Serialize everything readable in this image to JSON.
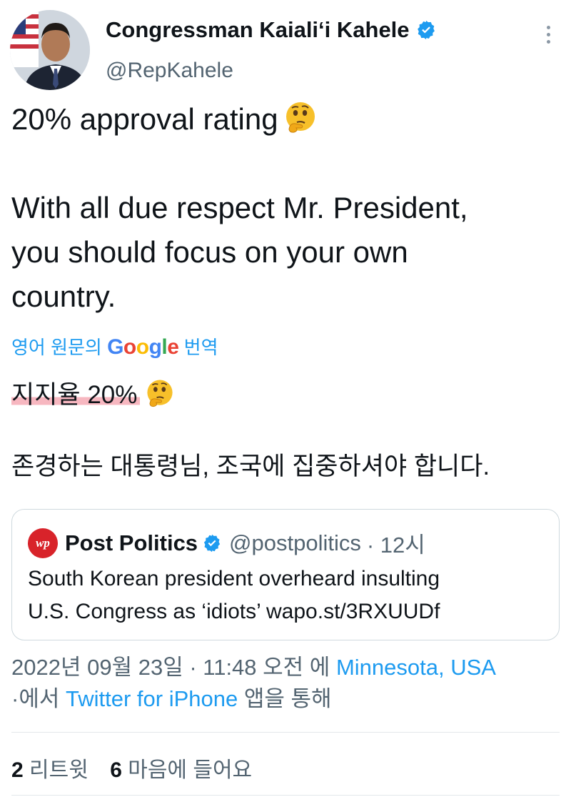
{
  "author": {
    "name": "Congressman Kaiali‘i Kahele",
    "handle": "@RepKahele"
  },
  "tweet": {
    "line1": "20% approval rating",
    "line2": "With all due respect Mr. President,",
    "line3": "you should focus on your own",
    "line4": "country."
  },
  "translation": {
    "prefix": "영어 원문의",
    "google": "Google",
    "suffix": "번역",
    "line1": "지지율 20%",
    "line2": "존경하는 대통령님, 조국에 집중하셔야 합니다."
  },
  "quote": {
    "logo_text": "wp",
    "name": "Post Politics",
    "handle": "@postpolitics",
    "time": "· 12시",
    "line1": "South Korean president overheard insulting",
    "line2": "U.S. Congress as ‘idiots’ wapo.st/3RXUUDf"
  },
  "meta": {
    "date": "2022년 09월 23일 · 11:48 오전 에",
    "location": "Minnesota, USA",
    "via_prefix": "·에서",
    "app": "Twitter for iPhone",
    "via_suffix": "앱을 통해"
  },
  "stats": {
    "retweets": "2",
    "retweets_label": "리트윗",
    "likes": "6",
    "likes_label": "마음에 들어요"
  },
  "colors": {
    "link": "#1d9bf0",
    "verified": "#1d9bf0",
    "highlight": "#f7b7c0",
    "secondary_text": "#536471"
  },
  "icons": {
    "verified": "verified-badge-icon",
    "emoji": "thinking-face-emoji",
    "more": "more-options-icon"
  }
}
